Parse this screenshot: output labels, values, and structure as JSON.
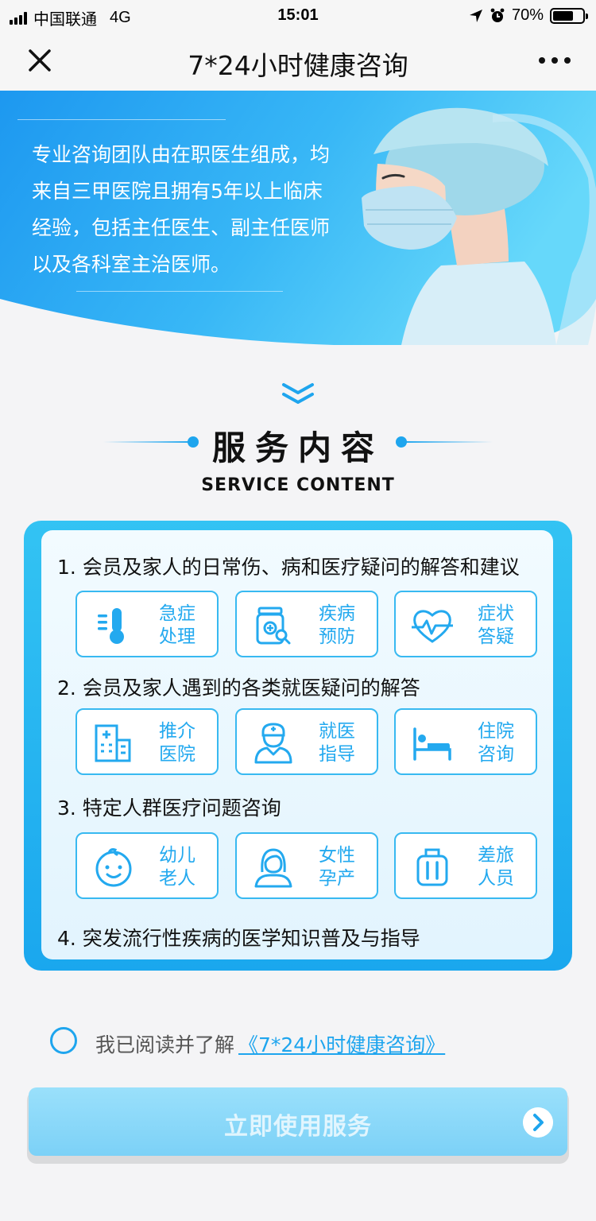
{
  "status_bar": {
    "carrier": "中国联通",
    "network": "4G",
    "time": "15:01",
    "battery": "70%",
    "battery_level": 0.7
  },
  "nav": {
    "title": "7*24小时健康咨询",
    "close_icon": "close-icon",
    "more_icon": "more-dots-icon"
  },
  "hero": {
    "description": "专业咨询团队由在职医生组成，均来自三甲医院且拥有5年以上临床经验，包括主任医生、副主任医师以及各科室主治医师。",
    "image": "doctor-with-mask-illustration"
  },
  "section": {
    "title": "服务内容",
    "subtitle": "SERVICE CONTENT"
  },
  "services": {
    "groups": [
      {
        "heading": "1. 会员及家人的日常伤、病和医疗疑问的解答和建议",
        "tiles": [
          {
            "line1": "急症",
            "line2": "处理",
            "icon": "thermometer-icon"
          },
          {
            "line1": "疾病",
            "line2": "预防",
            "icon": "medicine-bottle-icon"
          },
          {
            "line1": "症状",
            "line2": "答疑",
            "icon": "heart-pulse-icon"
          }
        ]
      },
      {
        "heading": "2. 会员及家人遇到的各类就医疑问的解答",
        "tiles": [
          {
            "line1": "推介",
            "line2": "医院",
            "icon": "hospital-building-icon"
          },
          {
            "line1": "就医",
            "line2": "指导",
            "icon": "doctor-icon"
          },
          {
            "line1": "住院",
            "line2": "咨询",
            "icon": "hospital-bed-icon"
          }
        ]
      },
      {
        "heading": "3. 特定人群医疗问题咨询",
        "tiles": [
          {
            "line1": "幼儿",
            "line2": "老人",
            "icon": "baby-face-icon"
          },
          {
            "line1": "女性",
            "line2": "孕产",
            "icon": "woman-icon"
          },
          {
            "line1": "差旅",
            "line2": "人员",
            "icon": "luggage-icon"
          }
        ]
      },
      {
        "heading": "4. 突发流行性疾病的医学知识普及与指导",
        "tiles": []
      }
    ]
  },
  "agreement": {
    "text": "我已阅读并了解",
    "link": "《7*24小时健康咨询》",
    "checked": false
  },
  "cta": {
    "label": "立即使用服务",
    "icon": "chevron-right-icon"
  },
  "colors": {
    "accent": "#1ea5ee",
    "hero_gradient_start": "#1e9bf0",
    "hero_gradient_end": "#5cd3f9",
    "button": "#8ad8f9"
  }
}
